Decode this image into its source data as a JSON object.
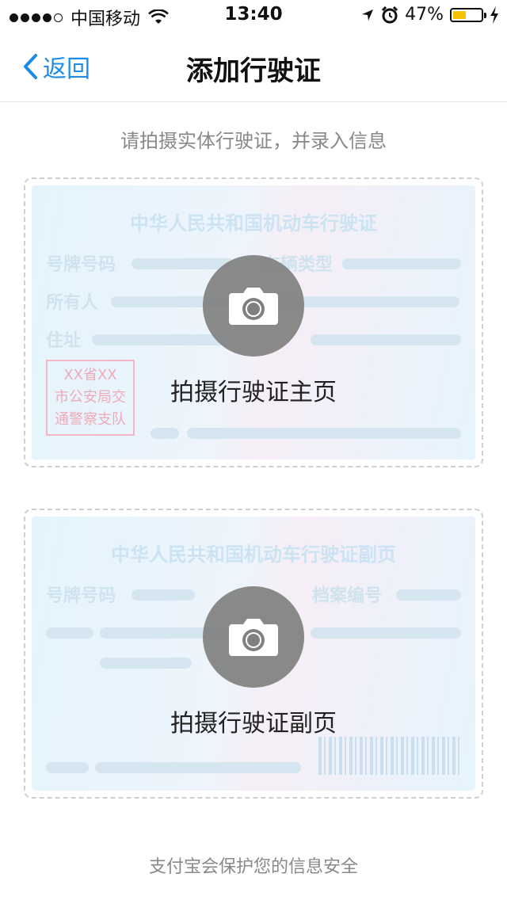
{
  "status_bar": {
    "carrier": "中国移动",
    "time": "13:40",
    "battery": "47%",
    "battery_level": 0.47,
    "icons": [
      "signal-icon",
      "wifi-icon",
      "location-icon",
      "alarm-icon",
      "battery-icon",
      "charging-icon"
    ]
  },
  "nav": {
    "back_label": "返回",
    "title": "添加行驶证"
  },
  "hint": "请拍摄实体行驶证，并录入信息",
  "front_card": {
    "watermark_title": "中华人民共和国机动车行驶证",
    "fields": [
      "号牌号码",
      "车辆类型",
      "所有人",
      "住址"
    ],
    "stamp": [
      "XX省XX",
      "市公安局交",
      "通警察支队"
    ],
    "action_label": "拍摄行驶证主页"
  },
  "back_card": {
    "watermark_title": "中华人民共和国机动车行驶证副页",
    "fields": [
      "号牌号码",
      "档案编号"
    ],
    "action_label": "拍摄行驶证副页"
  },
  "footer": "支付宝会保护您的信息安全",
  "colors": {
    "accent": "#1e8ce6",
    "camera_circle": "#808080",
    "battery_fill": "#f5c400"
  }
}
